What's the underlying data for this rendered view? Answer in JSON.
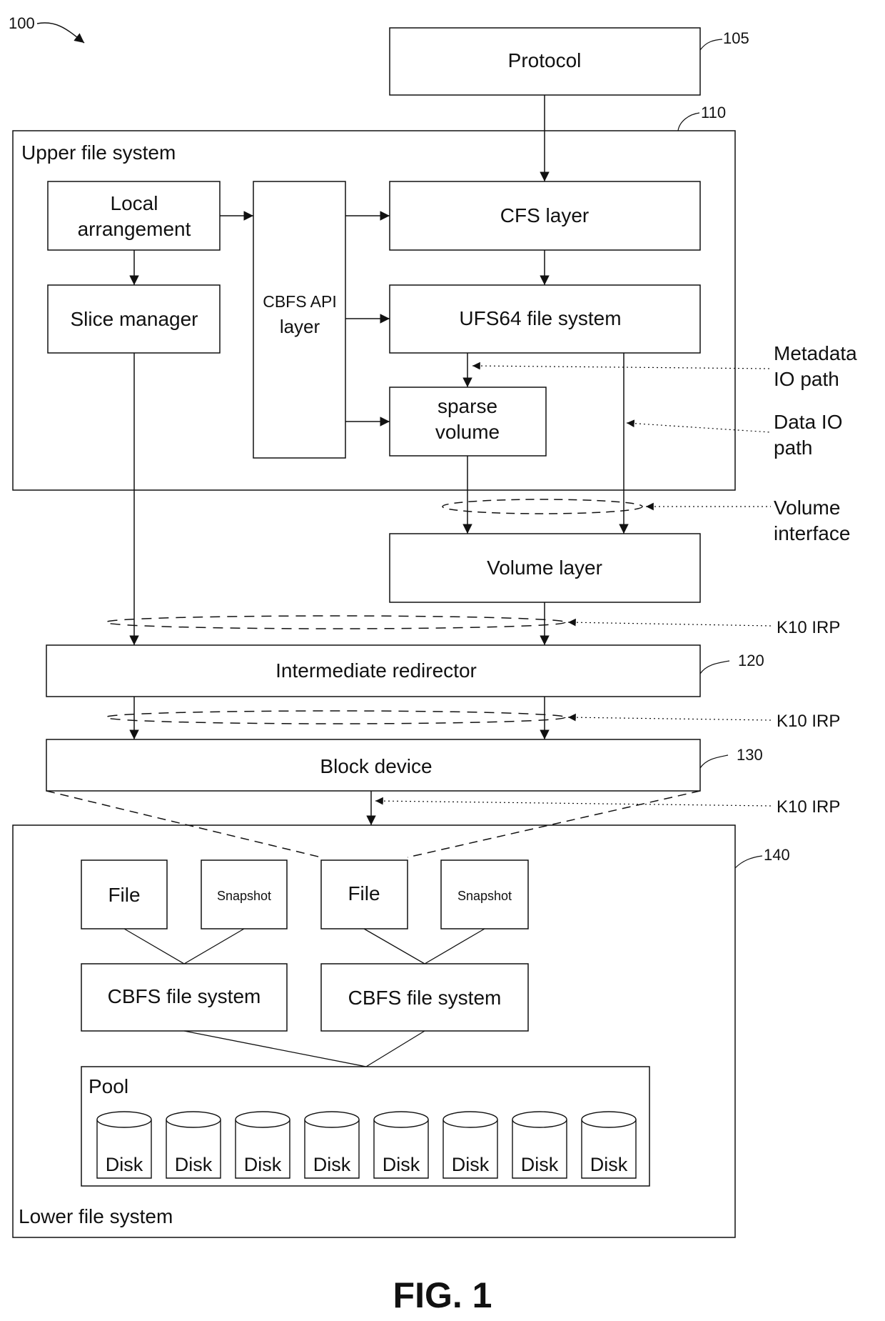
{
  "figure": {
    "caption": "FIG. 1",
    "ref_main": "100"
  },
  "protocol": {
    "label": "Protocol",
    "ref": "105"
  },
  "upper_fs": {
    "title": "Upper file system",
    "ref": "110",
    "local_arrangement": [
      "Local",
      "arrangement"
    ],
    "slice_manager": "Slice manager",
    "cbfs_api": [
      "CBFS API",
      "layer"
    ],
    "cfs_layer": "CFS layer",
    "ufs64": "UFS64 file system",
    "sparse_volume": [
      "sparse",
      "volume"
    ]
  },
  "volume_layer": {
    "label": "Volume layer"
  },
  "intermediate_redirector": {
    "label": "Intermediate redirector",
    "ref": "120"
  },
  "block_device": {
    "label": "Block device",
    "ref": "130"
  },
  "annotations": {
    "metadata_io": [
      "Metadata",
      "IO path"
    ],
    "data_io": [
      "Data IO",
      "path"
    ],
    "volume_interface": [
      "Volume",
      "interface"
    ],
    "k10_irp_1": "K10 IRP",
    "k10_irp_2": "K10 IRP",
    "k10_irp_3": "K10 IRP"
  },
  "lower_fs": {
    "title": "Lower file system",
    "ref": "140",
    "groups": [
      {
        "file": "File",
        "snapshot": "Snapshot",
        "cbfs": "CBFS file system"
      },
      {
        "file": "File",
        "snapshot": "Snapshot",
        "cbfs": "CBFS file system"
      }
    ],
    "pool": {
      "title": "Pool",
      "disks": [
        "Disk",
        "Disk",
        "Disk",
        "Disk",
        "Disk",
        "Disk",
        "Disk",
        "Disk"
      ]
    }
  }
}
